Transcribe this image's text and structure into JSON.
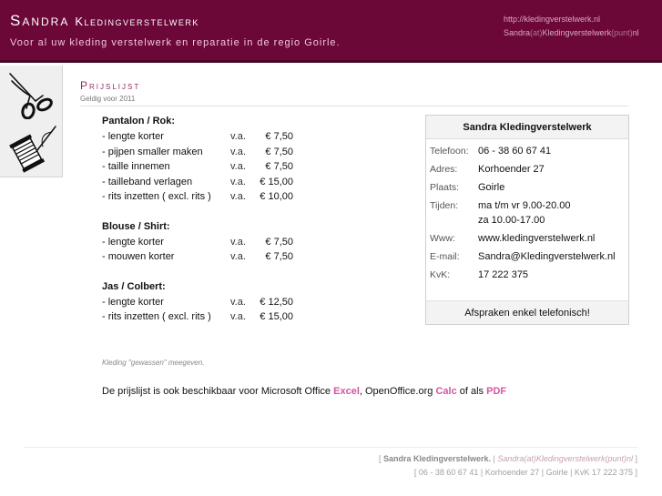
{
  "header": {
    "title_first": "Sandra",
    "title_second": "Kledingverstelwerk",
    "tagline": "Voor al uw kleding verstelwerk en reparatie in de regio Goirle.",
    "url": "http://kledingverstelwerk.nl",
    "email_a": "Sandra",
    "email_at": "(at)",
    "email_b": "Kledingverstelwerk",
    "email_dot": "(punt)",
    "email_c": "nl"
  },
  "sidebar": {
    "items": [
      {
        "icon": "scissors-icon"
      },
      {
        "icon": "needle-thread-icon"
      }
    ]
  },
  "page": {
    "title": "Prijslijst",
    "subtitle": "Geldig voor 2011"
  },
  "prices": [
    {
      "title": "Pantalon / Rok:",
      "rows": [
        {
          "label": "- lengte korter",
          "va": "v.a.",
          "price": "€ 7,50"
        },
        {
          "label": "- pijpen smaller maken",
          "va": "v.a.",
          "price": "€ 7,50"
        },
        {
          "label": "- taille innemen",
          "va": "v.a.",
          "price": "€ 7,50"
        },
        {
          "label": "- tailleband verlagen",
          "va": "v.a.",
          "price": "€ 15,00"
        },
        {
          "label": "- rits inzetten ( excl. rits )",
          "va": "v.a.",
          "price": "€ 10,00"
        }
      ]
    },
    {
      "title": "Blouse / Shirt:",
      "rows": [
        {
          "label": "- lengte korter",
          "va": "v.a.",
          "price": "€ 7,50"
        },
        {
          "label": "- mouwen korter",
          "va": "v.a.",
          "price": "€ 7,50"
        }
      ]
    },
    {
      "title": "Jas / Colbert:",
      "rows": [
        {
          "label": "- lengte korter",
          "va": "v.a.",
          "price": "€ 12,50"
        },
        {
          "label": "- rits inzetten ( excl. rits )",
          "va": "v.a.",
          "price": "€ 15,00"
        }
      ]
    }
  ],
  "contact": {
    "heading": "Sandra Kledingverstelwerk",
    "phone_label": "Telefoon:",
    "phone": "06 - 38 60 67 41",
    "address_label": "Adres:",
    "address": "Korhoender 27",
    "city_label": "Plaats:",
    "city": "Goirle",
    "hours_label": "Tijden:",
    "hours_1": "ma t/m vr 9.00-20.00",
    "hours_2": "za 10.00-17.00",
    "www_label": "Www:",
    "www": "www.kledingverstelwerk.nl",
    "email_label": "E-mail:",
    "email": "Sandra@Kledingverstelwerk.nl",
    "kvk_label": "KvK:",
    "kvk": "17 222 375",
    "footer": "Afspraken enkel telefonisch!"
  },
  "note": "Kleding \"gewassen\" meegeven.",
  "availability": {
    "text_1": "De prijslijst is ook beschikbaar voor Microsoft Office",
    "excel": "Excel",
    "text_2": ", OpenOffice.org",
    "calc": "Calc",
    "text_3": "of als",
    "pdf": "PDF"
  },
  "footer": {
    "bracket_open": "[",
    "name": "Sandra Kledingverstelwerk.",
    "sep": "|",
    "email_obf": "Sandra(at)Kledingverstelwerk(punt)nl",
    "bracket_close": "]",
    "line2": "[ 06 - 38 60 67 41 | Korhoender 27 | Goirle | KvK 17 222 375 ]"
  },
  "colors": {
    "header_bg": "#6c0838",
    "accent": "#8e2e64",
    "link": "#d257a0"
  }
}
